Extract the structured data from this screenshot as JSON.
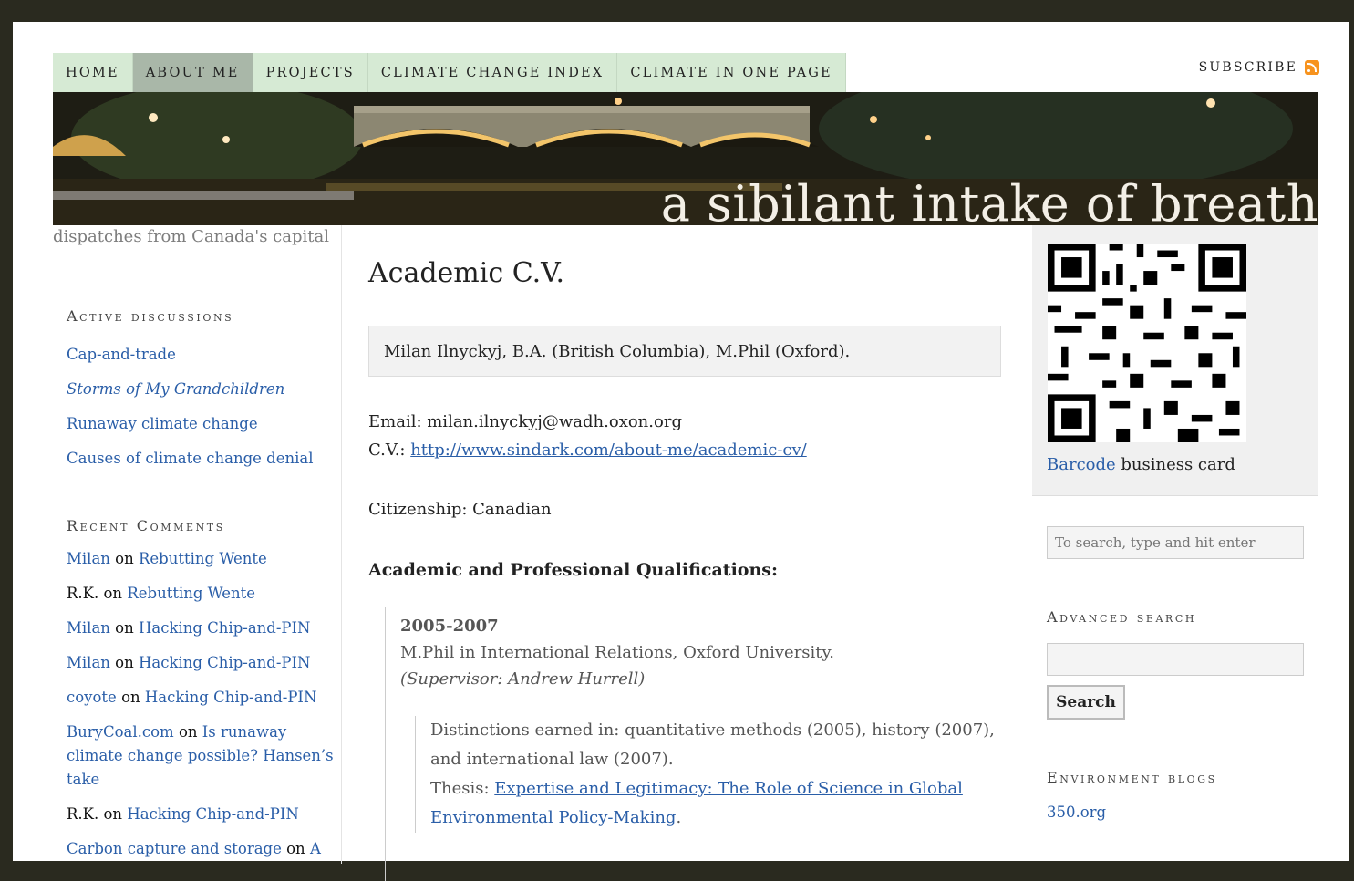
{
  "nav": {
    "items": [
      "Home",
      "About Me",
      "Projects",
      "Climate Change Index",
      "Climate in One Page"
    ],
    "active_index": 1,
    "subscribe_label": "Subscribe"
  },
  "banner": {
    "title": "a sibilant intake of breath",
    "tagline": "dispatches from Canada's capital"
  },
  "left_sidebar": {
    "active_discussions": {
      "heading": "Active discussions",
      "items": [
        "Cap-and-trade",
        "Storms of My Grandchildren",
        "Runaway climate change",
        "Causes of climate change denial"
      ]
    },
    "recent_comments": {
      "heading": "Recent Comments",
      "items": [
        {
          "author": "Milan",
          "on": "on",
          "post": "Rebutting Wente"
        },
        {
          "author": "R.K.",
          "on": "on",
          "post": "Rebutting Wente"
        },
        {
          "author": "Milan",
          "on": "on",
          "post": "Hacking Chip-and-PIN"
        },
        {
          "author": "Milan",
          "on": "on",
          "post": "Hacking Chip-and-PIN"
        },
        {
          "author": "coyote",
          "on": "on",
          "post": "Hacking Chip-and-PIN"
        },
        {
          "author": "BuryCoal.com",
          "on": "on",
          "post": "Is runaway climate change possible? Hansen’s take"
        },
        {
          "author": "R.K.",
          "on": "on",
          "post": "Hacking Chip-and-PIN"
        },
        {
          "author": "Carbon capture and storage",
          "on": "on",
          "post": "A"
        }
      ]
    }
  },
  "main": {
    "title": "Academic C.V.",
    "name_line": "Milan Ilnyckyj, B.A. (British Columbia), M.Phil (Oxford).",
    "email_label": "Email: milan.ilnyckyj@wadh.oxon.org",
    "cv_label": "C.V.: ",
    "cv_link": "http://www.sindark.com/about-me/academic-cv/",
    "citizenship": "Citizenship: Canadian",
    "qualifications_heading": "Academic and Professional Qualifications:",
    "entry": {
      "years": "2005-2007",
      "degree": "M.Phil in International Relations, Oxford University.",
      "supervisor": "(Supervisor: Andrew Hurrell)",
      "distinctions": "Distinctions earned in: quantitative methods (2005), history (2007), and international law (2007).",
      "thesis_label": "Thesis: ",
      "thesis_link": "Expertise and Legitimacy: The Role of Science in Global Environmental Policy-Making",
      "thesis_end": "."
    }
  },
  "right_sidebar": {
    "barcode_link": "Barcode",
    "barcode_rest": " business card",
    "search_placeholder": "To search, type and hit enter",
    "advanced_heading": "Advanced search",
    "search_button": "Search",
    "env_heading": "Environment blogs",
    "env_items": [
      "350.org"
    ]
  }
}
